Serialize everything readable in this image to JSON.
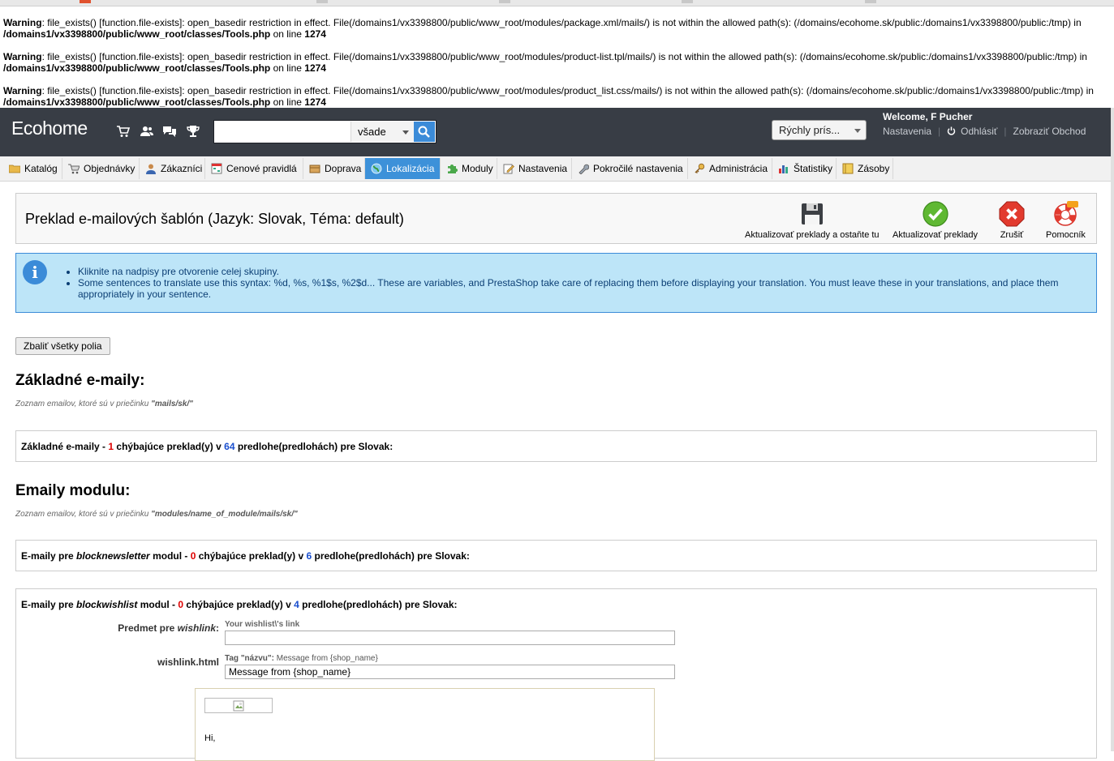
{
  "warnings": [
    {
      "label": "Warning",
      "text": ": file_exists() [function.file-exists]: open_basedir restriction in effect. File(/domains1/vx3398800/public/www_root/modules/package.xml/mails/) is not within the allowed path(s): (/domains/ecohome.sk/public:/domains1/vx3398800/public:/tmp) in",
      "path": "/domains1/vx3398800/public/www_root/classes/Tools.php",
      "online": " on line ",
      "line": "1274"
    },
    {
      "label": "Warning",
      "text": ": file_exists() [function.file-exists]: open_basedir restriction in effect. File(/domains1/vx3398800/public/www_root/modules/product-list.tpl/mails/) is not within the allowed path(s): (/domains/ecohome.sk/public:/domains1/vx3398800/public:/tmp) in",
      "path": "/domains1/vx3398800/public/www_root/classes/Tools.php",
      "online": " on line ",
      "line": "1274"
    },
    {
      "label": "Warning",
      "text": ": file_exists() [function.file-exists]: open_basedir restriction in effect. File(/domains1/vx3398800/public/www_root/modules/product_list.css/mails/) is not within the allowed path(s): (/domains/ecohome.sk/public:/domains1/vx3398800/public:/tmp) in",
      "path": "/domains1/vx3398800/public/www_root/classes/Tools.php",
      "online": " on line ",
      "line": "1274"
    }
  ],
  "header": {
    "logo": "Ecohome",
    "search_scope": "všade",
    "search_value": "",
    "quick_access": "Rýchly prís...",
    "welcome": "Welcome, F Pucher",
    "links": {
      "settings": "Nastavenia",
      "logout": "Odhlásiť",
      "view_shop": "Zobraziť Obchod"
    }
  },
  "tabs": [
    {
      "label": "Katalóg"
    },
    {
      "label": "Objednávky"
    },
    {
      "label": "Zákazníci"
    },
    {
      "label": "Cenové pravidlá"
    },
    {
      "label": "Doprava"
    },
    {
      "label": "Lokalizácia"
    },
    {
      "label": "Moduly"
    },
    {
      "label": "Nastavenia"
    },
    {
      "label": "Pokročilé nastavenia"
    },
    {
      "label": "Administrácia"
    },
    {
      "label": "Štatistiky"
    },
    {
      "label": "Zásoby"
    }
  ],
  "toolbar": {
    "title": "Preklad e-mailových šablón (Jazyk: Slovak, Téma: default)",
    "save_stay": "Aktualizovať preklady a ostaňte tu",
    "save": "Aktualizovať preklady",
    "cancel": "Zrušiť",
    "help": "Pomocník"
  },
  "info": {
    "items": [
      "Kliknite na nadpisy pre otvorenie celej skupiny.",
      "Some sentences to translate use this syntax: %d, %s, %1$s, %2$d... These are variables, and PrestaShop take care of replacing them before displaying your translation. You must leave these in your translations, and place them appropriately in your sentence."
    ]
  },
  "collapse_button": "Zbaliť všetky polia",
  "core": {
    "title": "Základné e-maily:",
    "note_prefix": "Zoznam emailov, ktoré sú v priečinku ",
    "note_path": "\"mails/sk/\"",
    "group": {
      "name": "Základné e-maily",
      "missing": "1",
      "total": "64",
      "lang": "Slovak"
    }
  },
  "modules": {
    "title": "Emaily modulu:",
    "note_prefix": "Zoznam emailov, ktoré sú v priečinku ",
    "note_path": "\"modules/name_of_module/mails/sk/\"",
    "groups": [
      {
        "prefix": "E-maily pre ",
        "module": "blocknewsletter",
        "suffix": " modul",
        "missing": "0",
        "total": "6",
        "lang": "Slovak"
      },
      {
        "prefix": "E-maily pre ",
        "module": "blockwishlist",
        "suffix": " modul",
        "missing": "0",
        "total": "4",
        "lang": "Slovak"
      }
    ],
    "texts": {
      "sep": " - ",
      "missing_text": " chýbajúce preklad(y) v ",
      "templates_text": " predlohe(predlohách) pre "
    }
  },
  "fields": {
    "subject_label_prefix": "Predmet pre ",
    "subject_label_name": "wishlink",
    "subject_label_suffix": ":",
    "subject_hint": "Your wishlist\\'s link",
    "subject_value": "",
    "html_label": "wishlink.html",
    "tag_hint_bold": "Tag \"názvu\":",
    "tag_hint_text": " Message from {shop_name}",
    "tag_value": "Message from {shop_name}",
    "preview_greeting": "Hi,"
  },
  "colors": {
    "header_bg": "#383d45",
    "active_tab": "#3d91d9",
    "info_bg": "#bde5f8",
    "missing": "#dd0000",
    "total": "#1a4fce"
  }
}
